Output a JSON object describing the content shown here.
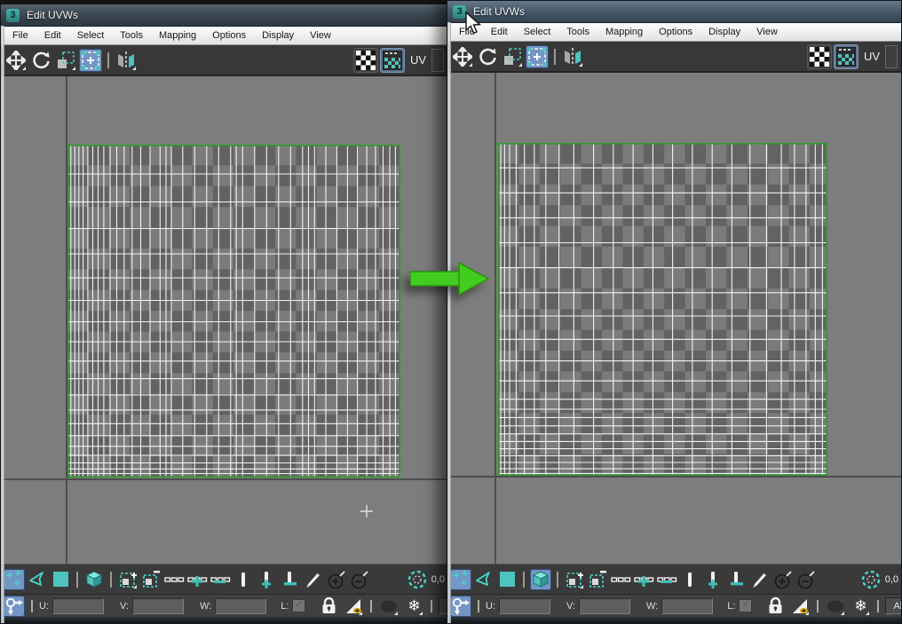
{
  "shared": {
    "window_title": "Edit UVWs",
    "logo_glyph": "3",
    "menus": [
      "File",
      "Edit",
      "Select",
      "Tools",
      "Mapping",
      "Options",
      "Display",
      "View"
    ],
    "uv_space_label": "UV",
    "coord_readout": "0,0",
    "status": {
      "u": "U:",
      "v": "V:",
      "w": "W:",
      "l": "L:",
      "material_filter": "All IDs"
    },
    "icon_glyphs": {
      "snowflake": "❄",
      "check": "✓"
    }
  },
  "left_window": {
    "mesh": {
      "u_lines": [
        0.01,
        0.022,
        0.034,
        0.047,
        0.061,
        0.076,
        0.092,
        0.109,
        0.128,
        0.148,
        0.17,
        0.194,
        0.22,
        0.248,
        0.278,
        0.296,
        0.312,
        0.346,
        0.382,
        0.418,
        0.454,
        0.49,
        0.507,
        0.526,
        0.562,
        0.598,
        0.634,
        0.67,
        0.706,
        0.724,
        0.742,
        0.776,
        0.809,
        0.841,
        0.871,
        0.899,
        0.925,
        0.948,
        0.968,
        0.985
      ],
      "v_lines": [
        0.088,
        0.172,
        0.252,
        0.328,
        0.4,
        0.468,
        0.532,
        0.592,
        0.65,
        0.703,
        0.752,
        0.797,
        0.838,
        0.874,
        0.906,
        0.933,
        0.956,
        0.974,
        0.988
      ]
    },
    "element_mode_on": false
  },
  "right_window": {
    "mesh": {
      "u_lines": [
        0.008,
        0.02,
        0.035,
        0.055,
        0.08,
        0.11,
        0.145,
        0.185,
        0.23,
        0.29,
        0.35,
        0.41,
        0.47,
        0.53,
        0.59,
        0.65,
        0.71,
        0.765,
        0.815,
        0.86,
        0.9,
        0.935,
        0.963,
        0.985
      ],
      "v_lines": [
        0.075,
        0.15,
        0.225,
        0.3,
        0.375,
        0.45,
        0.52,
        0.59,
        0.655,
        0.715,
        0.77,
        0.8,
        0.825,
        0.85,
        0.874,
        0.897,
        0.919,
        0.94,
        0.96,
        0.979,
        0.993
      ]
    },
    "element_mode_on": true
  },
  "colors": {
    "accent_teal": "#4fc3bd",
    "pressed_blue": "#7496c4",
    "mesh_green": "#2e9b2e",
    "arrow_green": "#41cc1f",
    "checker_light": "#7b7b7b",
    "checker_dark": "#626262"
  }
}
